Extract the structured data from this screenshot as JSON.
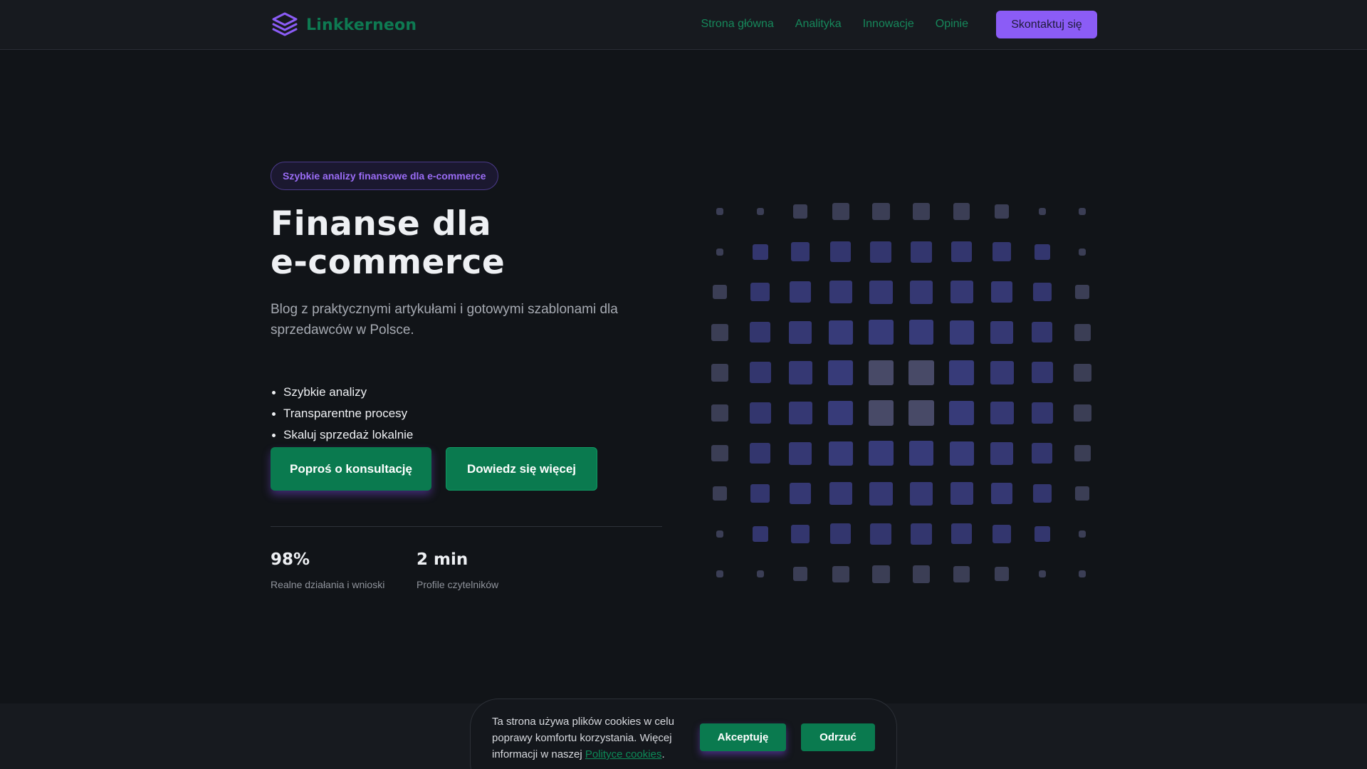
{
  "brand": {
    "name": "Linkkerneon",
    "icon": "layers-icon"
  },
  "nav": {
    "items": [
      "Strona główna",
      "Analityka",
      "Innowacje",
      "Opinie"
    ],
    "cta": "Skontaktuj się"
  },
  "hero": {
    "badge": "Szybkie analizy finansowe dla e-commerce",
    "title_line1": "Finanse dla",
    "title_line2": "e-commerce",
    "subtitle": "Blog z praktycznymi artykułami i gotowymi szablonami dla sprzedawców w Polsce.",
    "features": [
      "Szybkie analizy",
      "Transparentne procesy",
      "Skaluj sprzedaż lokalnie"
    ],
    "primary_button": "Poproś o konsultację",
    "secondary_button": "Dowiedz się więcej"
  },
  "stats": [
    {
      "value": "98%",
      "label": "Realne działania i wnioski"
    },
    {
      "value": "2 min",
      "label": "Profile czytelników"
    }
  ],
  "cookie": {
    "text": "Ta strona używa plików cookies w celu poprawy komfortu korzystania. Więcej informacji w naszej ",
    "link": "Polityce cookies",
    "suffix": ".",
    "accept": "Akceptuję",
    "reject": "Odrzuć"
  },
  "colors": {
    "accent_purple": "#8b5cf6",
    "accent_green": "#0a7a4f",
    "grid_indigo": "#3b3f82",
    "grid_slate": "#4a4c6a"
  }
}
